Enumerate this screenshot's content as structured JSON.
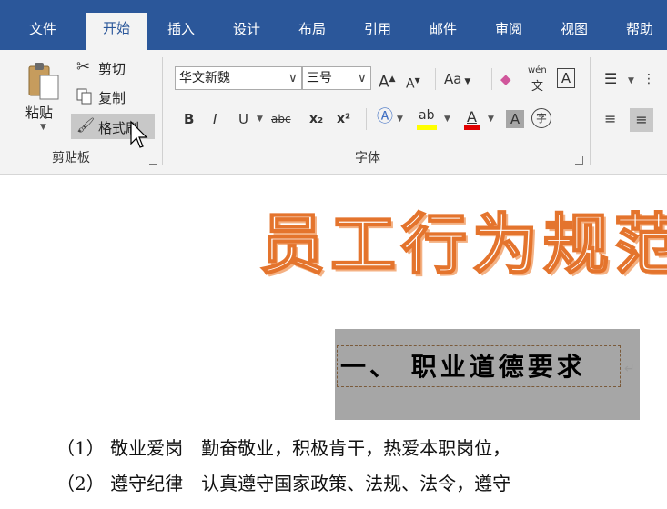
{
  "tabs": [
    {
      "label": "文件",
      "active": false
    },
    {
      "label": "开始",
      "active": true
    },
    {
      "label": "插入",
      "active": false
    },
    {
      "label": "设计",
      "active": false
    },
    {
      "label": "布局",
      "active": false
    },
    {
      "label": "引用",
      "active": false
    },
    {
      "label": "邮件",
      "active": false
    },
    {
      "label": "审阅",
      "active": false
    },
    {
      "label": "视图",
      "active": false
    },
    {
      "label": "帮助",
      "active": false
    }
  ],
  "clipboard": {
    "paste_label": "粘贴",
    "cut_label": "剪切",
    "copy_label": "复制",
    "format_painter_label": "格式刷",
    "group_label": "剪贴板"
  },
  "font": {
    "font_name": "华文新魏",
    "font_size": "三号",
    "case_label": "Aa",
    "phonetic_top": "wén",
    "phonetic_bottom": "文",
    "border_char": "A",
    "bold": "B",
    "italic": "I",
    "underline": "U",
    "strike": "abc",
    "subscript": "x₂",
    "superscript": "x²",
    "font_color_char": "A",
    "shade_char": "A",
    "enclose_char": "字",
    "group_label": "字体"
  },
  "document": {
    "title": "员工行为规范",
    "heading": "一、 职业道德要求",
    "lines": [
      "（1） 敬业爱岗　勤奋敬业，积极肯干，热爱本职岗位，",
      "（2） 遵守纪律　认真遵守国家政策、法规、法令，遵守"
    ]
  },
  "colors": {
    "ribbon_blue": "#2b579a",
    "title_orange": "#e4742d",
    "highlight_yellow": "#ffff00",
    "font_red": "#e00000"
  }
}
